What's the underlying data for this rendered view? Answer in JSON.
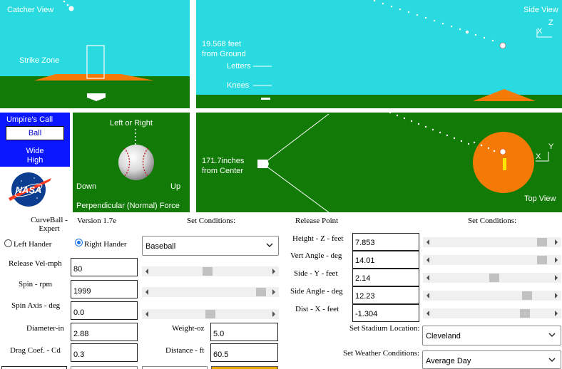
{
  "catcher_view": {
    "title": "Catcher View",
    "strike_zone_label": "Strike Zone"
  },
  "side_view": {
    "title": "Side View",
    "height_value": "19.568 feet",
    "height_caption": "from Ground",
    "letters_label": "Letters",
    "knees_label": "Knees",
    "axis_z": "Z",
    "axis_x": "X"
  },
  "umpire": {
    "title": "Umpire's Call",
    "call": "Ball",
    "location_1": "Wide",
    "location_2": "High"
  },
  "ball_panel": {
    "title": "Left or Right",
    "down_label": "Down",
    "up_label": "Up",
    "caption": "Perpendicular (Normal) Force"
  },
  "top_view": {
    "title": "Top View",
    "distance_value": "171.7inches",
    "distance_caption": "from Center",
    "axis_y": "Y",
    "axis_x": "X"
  },
  "app": {
    "name_line1": "CurveBall -",
    "name_line2": "Expert",
    "version": "Version 1.7e",
    "logo_text": "NASA"
  },
  "left_conditions": {
    "header": "Set Conditions:",
    "left_hander": "Left Hander",
    "right_hander": "Right Hander",
    "ball_type": "Baseball",
    "release_vel_label": "Release Vel-mph",
    "release_vel": "80",
    "release_vel_frac": 0.47,
    "spin_label": "Spin - rpm",
    "spin": "1999",
    "spin_frac": 0.97,
    "spin_axis_label": "Spin Axis - deg",
    "spin_axis": "0.0",
    "spin_axis_frac": 0.5,
    "diameter_label": "Diameter-in",
    "diameter": "2.88",
    "weight_label": "Weight-oz",
    "weight": "5.0",
    "drag_label": "Drag Coef. - Cd",
    "drag": "0.3",
    "distance_label": "Distance - ft",
    "distance": "60.5"
  },
  "release_point": {
    "header": "Release Point",
    "conditions_header": "Set Conditions:",
    "height_label": "Height - Z - feet",
    "height": "7.853",
    "height_frac": 0.96,
    "vert_angle_label": "Vert Angle - deg",
    "vert_angle": "14.01",
    "vert_angle_frac": 0.96,
    "side_label": "Side - Y - feet",
    "side": "2.14",
    "side_frac": 0.52,
    "side_angle_label": "Side Angle - deg",
    "side_angle": "12.23",
    "side_angle_frac": 0.82,
    "dist_label": "Dist - X - feet",
    "dist": "-1.304",
    "dist_frac": 0.8
  },
  "stadium": {
    "location_label": "Set Stadium Location:",
    "location": "Cleveland",
    "weather_label": "Set Weather Conditions:",
    "weather": "Average Day"
  }
}
